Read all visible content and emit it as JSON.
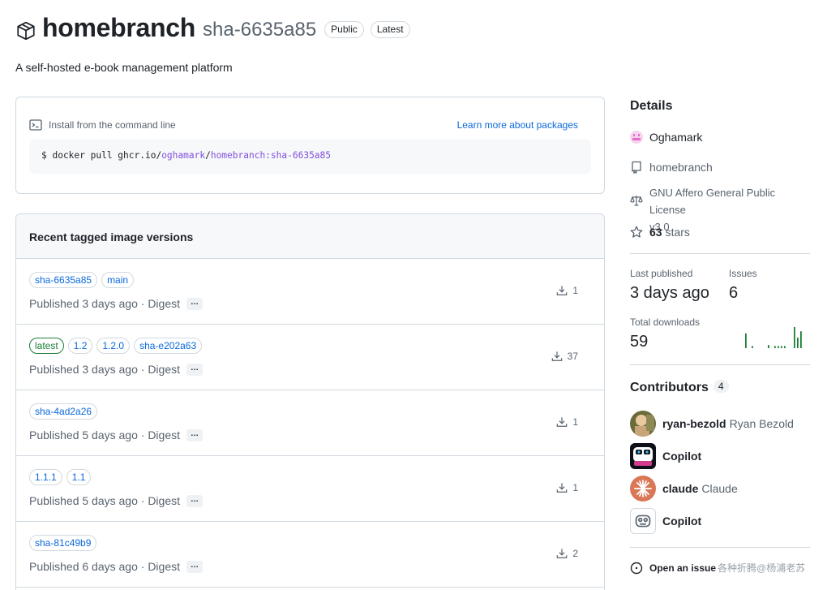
{
  "package": {
    "name": "homebranch",
    "version": "sha-6635a85",
    "badges": [
      "Public",
      "Latest"
    ],
    "description": "A self-hosted e-book management platform"
  },
  "install": {
    "label": "Install from the command line",
    "learn_more": "Learn more about packages",
    "command_prefix": "$ docker pull ghcr.io/",
    "command_owner": "oghamark",
    "command_sep": "/",
    "command_image": "homebranch:sha-6635a85"
  },
  "versions": {
    "title": "Recent tagged image versions",
    "rows": [
      {
        "tags": [
          "sha-6635a85",
          "main"
        ],
        "published": "Published 3 days ago · Digest",
        "downloads": "1"
      },
      {
        "tags": [
          "latest",
          "1.2",
          "1.2.0",
          "sha-e202a63"
        ],
        "published": "Published 3 days ago · Digest",
        "downloads": "37"
      },
      {
        "tags": [
          "sha-4ad2a26"
        ],
        "published": "Published 5 days ago · Digest",
        "downloads": "1"
      },
      {
        "tags": [
          "1.1.1",
          "1.1"
        ],
        "published": "Published 5 days ago · Digest",
        "downloads": "1"
      },
      {
        "tags": [
          "sha-81c49b9"
        ],
        "published": "Published 6 days ago · Digest",
        "downloads": "2"
      }
    ],
    "digest_more": "…"
  },
  "details": {
    "title": "Details",
    "owner": "Oghamark",
    "repo": "homebranch",
    "license_line1": "GNU Affero General Public License",
    "license_line2": "v3.0",
    "stars_count": "63",
    "stars_label": "stars"
  },
  "stats": {
    "last_published_label": "Last published",
    "last_published_value": "3 days ago",
    "issues_label": "Issues",
    "issues_value": "6",
    "total_downloads_label": "Total downloads",
    "total_downloads_value": "59",
    "sparkline_heights": [
      0.7,
      0,
      0.1,
      0,
      0,
      0,
      0,
      0.15,
      0,
      0.1,
      0.1,
      0.1,
      0.1,
      0,
      0,
      1.0,
      0.5,
      0.8
    ]
  },
  "contributors": {
    "title": "Contributors",
    "count": "4",
    "people": [
      {
        "login": "ryan-bezold",
        "name": "Ryan Bezold"
      },
      {
        "login": "Copilot",
        "name": ""
      },
      {
        "login": "claude",
        "name": "Claude"
      },
      {
        "login": "Copilot",
        "name": ""
      }
    ]
  },
  "footer": {
    "open_issue": "Open an issue",
    "watermark": "各种折腾@杨浦老苏"
  },
  "colors": {
    "link": "#0969da",
    "green": "#1a7f37",
    "muted": "#59636e",
    "border": "#d1d9e0"
  }
}
